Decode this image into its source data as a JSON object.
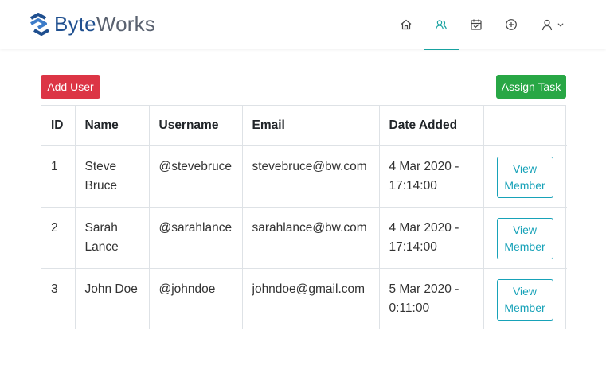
{
  "brand": {
    "part1": "Byte",
    "part2": "Works",
    "color_primary": "#1f4f8f",
    "color_secondary": "#5a6270"
  },
  "nav": {
    "icons": [
      "home-icon",
      "members-icon",
      "calendar-icon",
      "add-circle-icon",
      "user-icon",
      "chevron-down-icon"
    ],
    "active": "members-icon",
    "accent": "#17a2a0"
  },
  "actions": {
    "add_user": "Add User",
    "assign_task": "Assign Task"
  },
  "table": {
    "headers": {
      "id": "ID",
      "name": "Name",
      "username": "Username",
      "email": "Email",
      "date": "Date Added"
    },
    "rows": [
      {
        "id": "1",
        "name": "Steve Bruce",
        "username": "@stevebruce",
        "email": "stevebruce@bw.com",
        "date": "4 Mar 2020 - 17:14:00",
        "action": "View Member"
      },
      {
        "id": "2",
        "name": "Sarah Lance",
        "username": "@sarahlance",
        "email": "sarahlance@bw.com",
        "date": "4 Mar 2020 - 17:14:00",
        "action": "View Member"
      },
      {
        "id": "3",
        "name": "John Doe",
        "username": "@johndoe",
        "email": "johndoe@gmail.com",
        "date": "5 Mar 2020 - 0:11:00",
        "action": "View Member"
      }
    ]
  },
  "colors": {
    "danger": "#dc3545",
    "success": "#28a745",
    "info": "#17a2b8"
  }
}
